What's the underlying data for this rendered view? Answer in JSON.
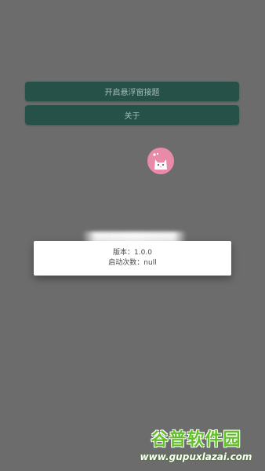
{
  "buttons": {
    "float_window_label": "开启悬浮窗接题",
    "about_label": "关于"
  },
  "dialog": {
    "version_label": "版本：",
    "version_value": "1.0.0",
    "launch_count_label": "启动次数：",
    "launch_count_value": "null"
  },
  "watermark": {
    "brand": "谷普软件园",
    "url": "www.gupuxlazai.com"
  },
  "colors": {
    "background": "#6c6c6c",
    "button": "#255148",
    "float_ball": "#e88aa8",
    "watermark": "#62bf2a"
  },
  "icons": {
    "float_ball": "cat-face-icon"
  }
}
